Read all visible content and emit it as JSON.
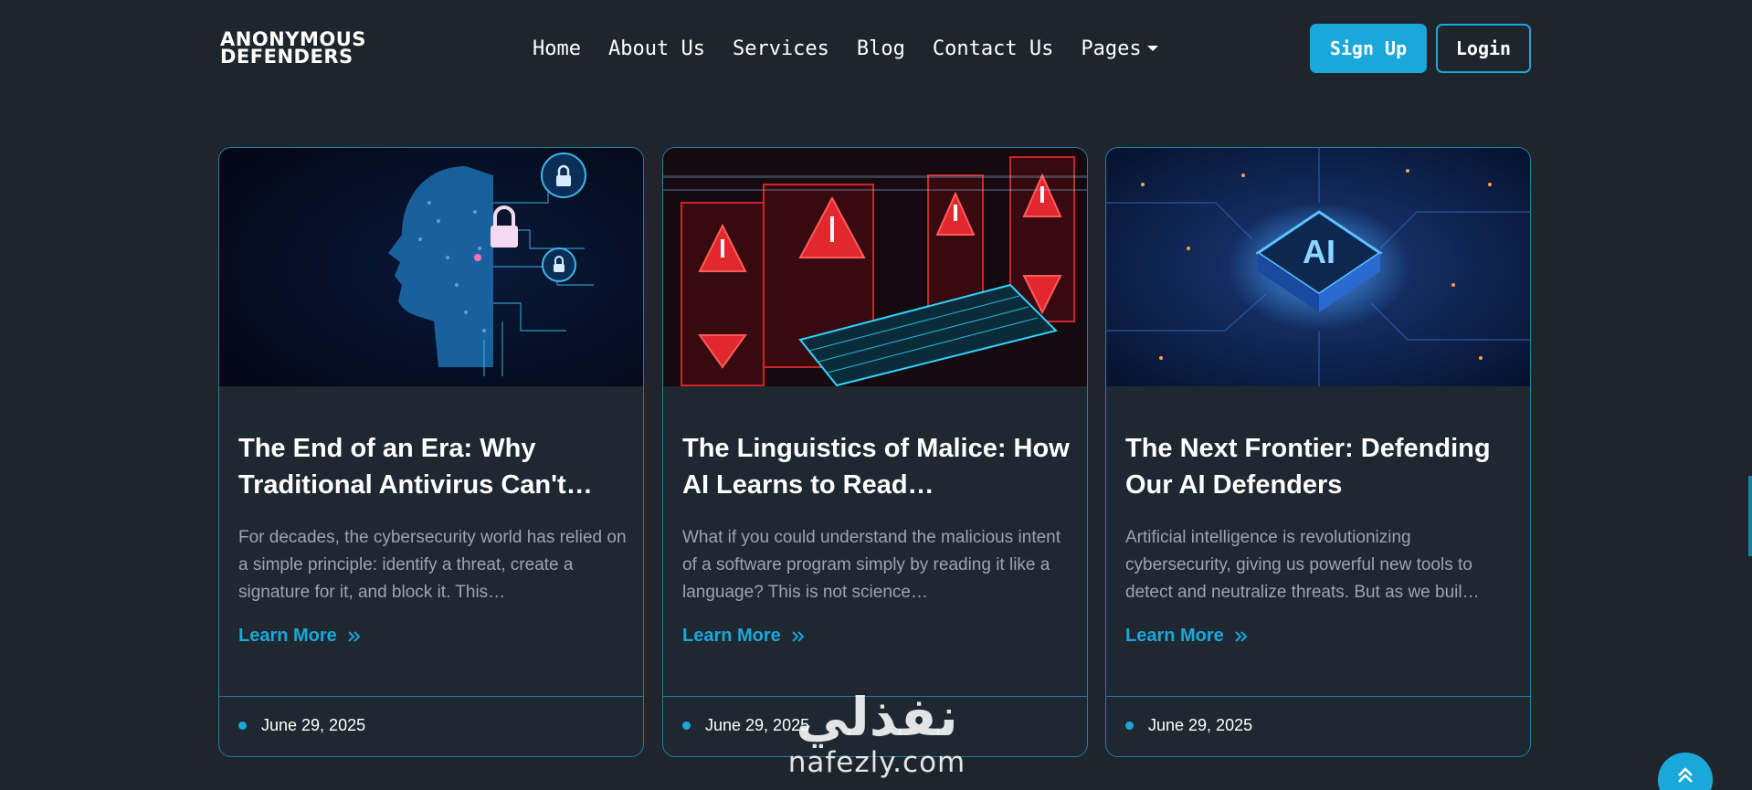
{
  "header": {
    "logo_line1": "ANONYMOUS",
    "logo_line2": "DEFENDERS",
    "nav": [
      "Home",
      "About Us",
      "Services",
      "Blog",
      "Contact Us",
      "Pages"
    ],
    "signup_label": "Sign Up",
    "login_label": "Login"
  },
  "cards": [
    {
      "title": "The End of an Era: Why Traditional Antivirus Can't…",
      "excerpt": "For decades, the cybersecurity world has relied on a simple principle: identify a threat, create a signature for it, and block it. This…",
      "link_label": "Learn More",
      "date": "June 29, 2025",
      "image_icon": "ai-head-lock-icon"
    },
    {
      "title": "The Linguistics of Malice: How AI Learns to Read…",
      "excerpt": "What if you could understand the malicious intent of a software program simply by reading it like a language? This is not science…",
      "link_label": "Learn More",
      "date": "June 29, 2025",
      "image_icon": "warning-keyboard-icon"
    },
    {
      "title": "The Next Frontier: Defending Our AI Defenders",
      "excerpt": "Artificial intelligence is revolutionizing cybersecurity, giving us powerful new tools to detect and neutralize threats. But as we buil…",
      "link_label": "Learn More",
      "date": "June 29, 2025",
      "image_icon": "ai-chip-icon",
      "image_text": "AI"
    }
  ],
  "watermark": {
    "arabic": "نفذلي",
    "latin": "nafezly.com"
  },
  "colors": {
    "background": "#1e252d",
    "accent": "#1aa7da",
    "card_border": "#1d7fa4",
    "muted_text": "#9aa5b1"
  }
}
